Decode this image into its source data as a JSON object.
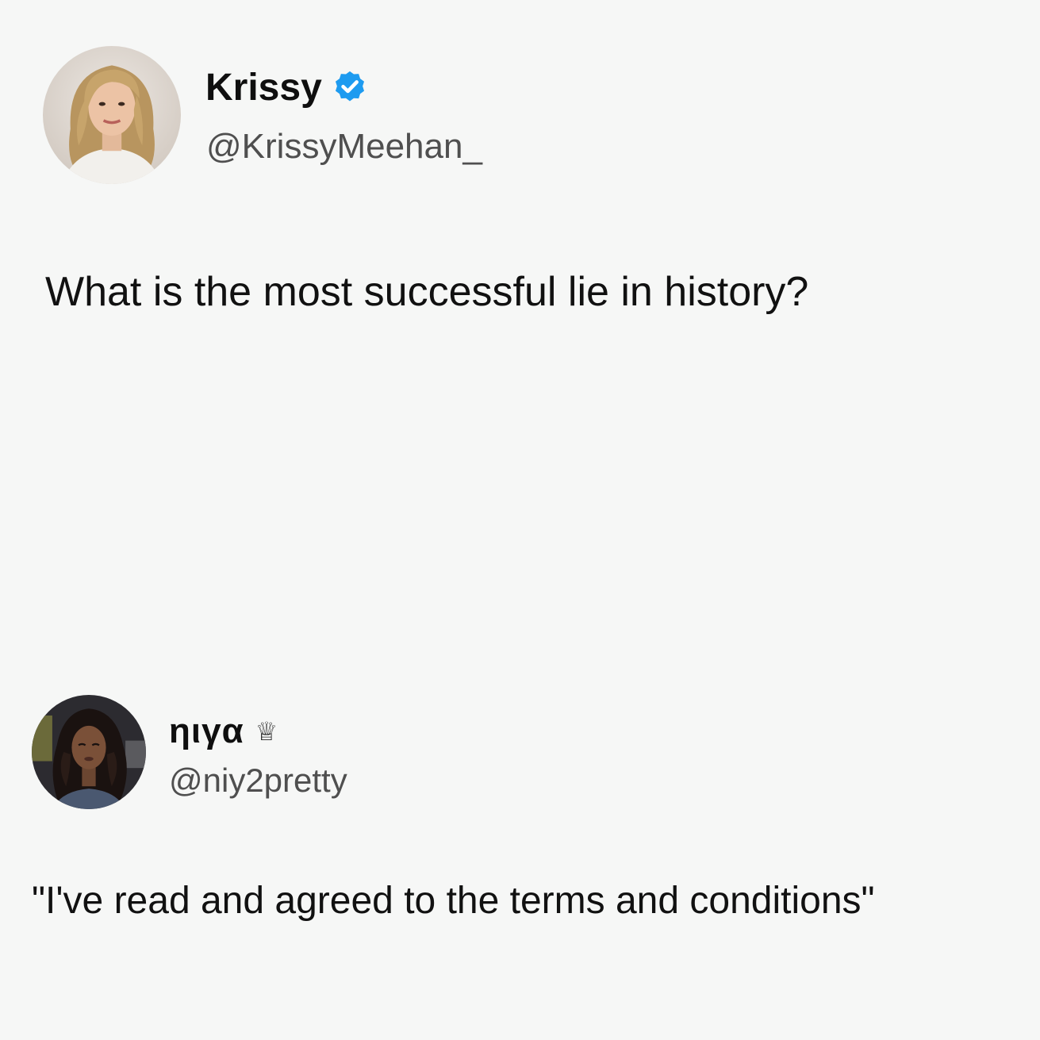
{
  "posts": [
    {
      "display_name": "Krissy",
      "handle": "@KrissyMeehan_",
      "verified": true,
      "text": "What is the most successful lie in history?"
    },
    {
      "display_name": "ηιγα",
      "handle": "@niy2pretty",
      "badge_glyph": "♕",
      "text": "\"I've read and agreed to the terms and conditions\""
    }
  ],
  "colors": {
    "background": "#f6f7f6",
    "verified": "#1d9bf0",
    "handle": "#4f4f4f",
    "text": "#111111"
  },
  "icons": {
    "verified": "verified-badge-icon",
    "crown": "crown-icon"
  }
}
